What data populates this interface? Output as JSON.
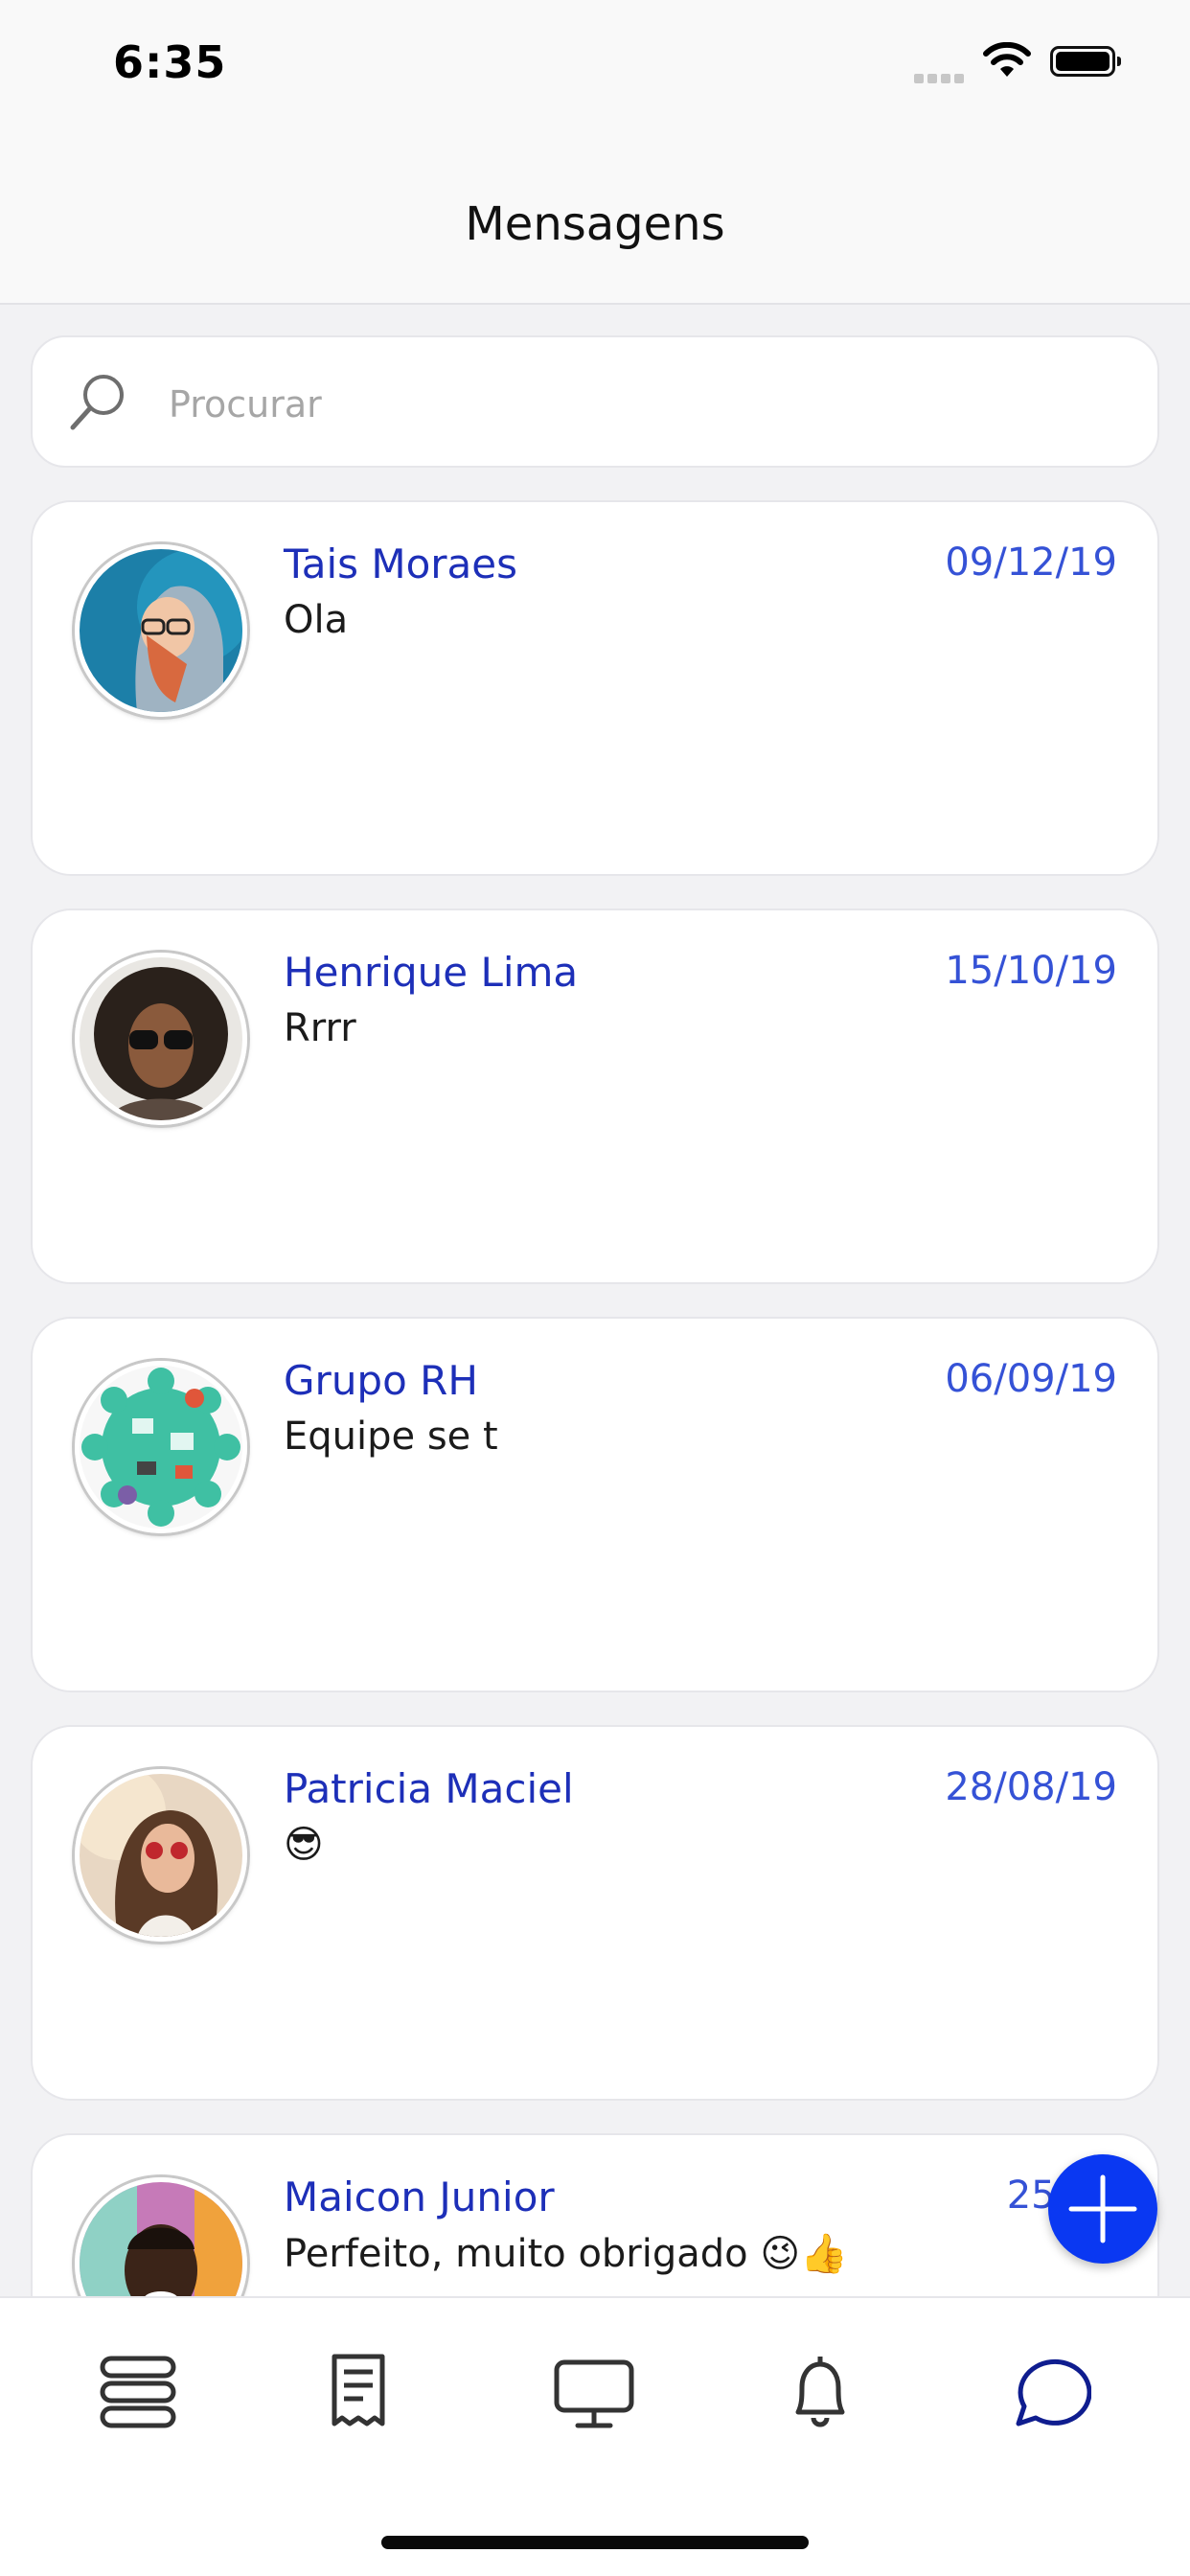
{
  "status_bar": {
    "time": "6:35"
  },
  "header": {
    "title": "Mensagens"
  },
  "search": {
    "placeholder": "Procurar",
    "value": ""
  },
  "conversations": [
    {
      "name": "Tais Moraes",
      "date": "09/12/19",
      "message": "Ola",
      "avatar": "person-hoodie-glasses"
    },
    {
      "name": "Henrique Lima",
      "date": "15/10/19",
      "message": "Rrrr",
      "avatar": "person-curly-hair-sunglasses"
    },
    {
      "name": "Grupo RH",
      "date": "06/09/19",
      "message": "Equipe se t",
      "avatar": "team-round-table-illustration"
    },
    {
      "name": "Patricia Maciel",
      "date": "28/08/19",
      "message": "😎",
      "avatar": "person-long-hair-sunglasses"
    },
    {
      "name": "Maicon Junior",
      "date": "25/07",
      "message": "Perfeito, muito obrigado 😉👍",
      "avatar": "person-smiling"
    }
  ],
  "fab": {
    "icon": "plus-icon"
  },
  "tabbar": {
    "items": [
      {
        "icon": "layers-icon",
        "active": false
      },
      {
        "icon": "receipt-icon",
        "active": false
      },
      {
        "icon": "monitor-icon",
        "active": false
      },
      {
        "icon": "bell-icon",
        "active": false
      },
      {
        "icon": "chat-bubble-icon",
        "active": true
      }
    ]
  },
  "colors": {
    "accent": "#1d2fb8",
    "fab": "#0a38f2",
    "date": "#3552d6"
  }
}
